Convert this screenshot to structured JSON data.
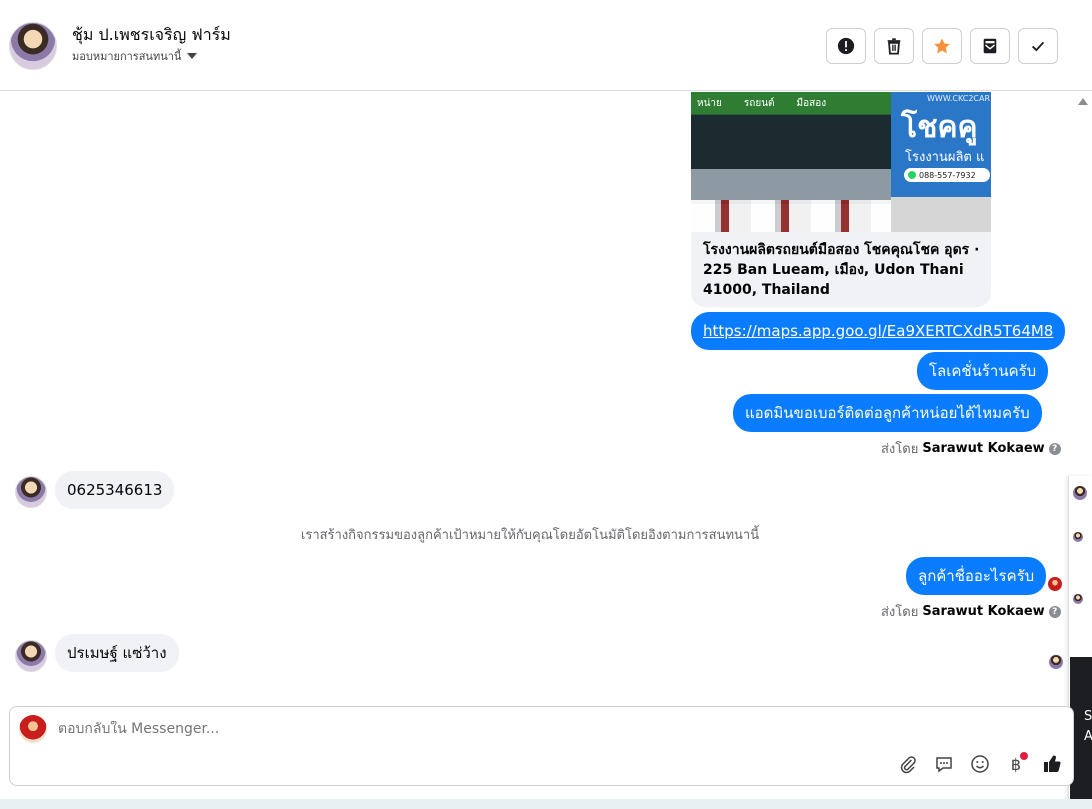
{
  "header": {
    "contact_name": "ชุ้ม ป.เพชรเจริญ ฟาร์ม",
    "assign_label": "มอบหมายการสนทนานี้",
    "toolbar": [
      {
        "icon": "alert-icon",
        "name": "mark-spam-button"
      },
      {
        "icon": "trash-icon",
        "name": "delete-button"
      },
      {
        "icon": "star-icon",
        "name": "star-button"
      },
      {
        "icon": "envelope-icon",
        "name": "mark-unread-button"
      },
      {
        "icon": "check-icon",
        "name": "mark-done-button"
      }
    ],
    "star_color": "#f7923b"
  },
  "link_card": {
    "brand_text": "โชคคู",
    "sub_text": "โรงงานผลิต แ",
    "url_text": "WWW.CKC2CAR",
    "phone_text": "088-557-7932",
    "sign_texts": [
      "หน่าย",
      "รถยนต์",
      "มือสอง"
    ],
    "title": "โรงงานผลิตรถยนต์มือสอง โชคคุณโชค อุดร · 225 Ban Lueam, เมือง, Udon Thani 41000, Thailand"
  },
  "messages": {
    "link": "https://maps.app.goo.gl/Ea9XERTCXdR5T64M8",
    "location": "โลเคชั่นร้านครับ",
    "ask_number": "แอดมินขอเบอร์ติดต่อลูกค้าหน่อยได้ไหมครับ",
    "sent_by_prefix": "ส่งโดย",
    "sent_by_name": "Sarawut Kokaew",
    "customer_phone": "0625346613",
    "system_note": "เราสร้างกิจกรรมของลูกค้าเป้าหมายให้กับคุณโดยอัตโนมัติโดยอิงตามการสนทนานี้",
    "ask_name": "ลูกค้าชื่ออะไรครับ",
    "sent_by_prefix_2": "ส่งโดย",
    "sent_by_name_2": "Sarawut Kokaew",
    "customer_name": "ปรเมษฐ์ แซ่ว้าง",
    "help_glyph": "?"
  },
  "side_panel": {
    "partial_text": "S\nA"
  },
  "composer": {
    "placeholder": "ตอบกลับใน Messenger...",
    "currency_glyph": "฿"
  },
  "colors": {
    "accent": "#0a7cff",
    "incoming_bubble": "#f0f2f5",
    "badge": "#e41e3f"
  }
}
